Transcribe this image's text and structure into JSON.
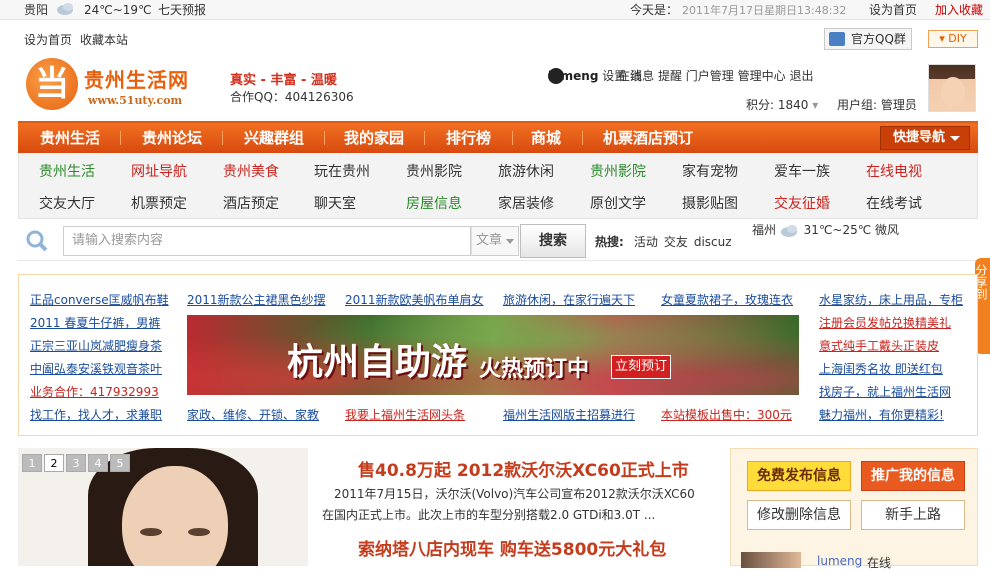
{
  "topbar": {
    "city": "贵阳",
    "temp": "24℃~19℃",
    "forecast": "七天预报",
    "today_label": "今天是：",
    "date": "2011年7月17日星期日13:48:32",
    "set_home": "设为首页",
    "add_fav": "加入收藏"
  },
  "bar2": {
    "set_home": "设为首页",
    "bookmark": "收藏本站",
    "qq_group": "官方QQ群",
    "diy": "DIY"
  },
  "logo": {
    "char": "当",
    "name": "贵州生活网",
    "url": "www.51uty.com"
  },
  "slogan": "真实 - 丰富 - 温暖",
  "coop": "合作QQ：404126306",
  "user": {
    "name": "lumeng",
    "status": "在线",
    "links": [
      "设置",
      "消息",
      "提醒",
      "门户管理",
      "管理中心",
      "退出"
    ],
    "points_label": "积分: 1840",
    "group": "用户组: 管理员"
  },
  "nav": {
    "items": [
      "贵州生活",
      "贵州论坛",
      "兴趣群组",
      "我的家园",
      "排行榜",
      "商城",
      "机票酒店预订"
    ],
    "quick": "快捷导航"
  },
  "subnav": {
    "row1": [
      "贵州生活",
      "网址导航",
      "贵州美食",
      "玩在贵州",
      "贵州影院",
      "旅游休闲",
      "贵州影院",
      "家有宠物",
      "爱车一族",
      "在线电视"
    ],
    "row2": [
      "交友大厅",
      "机票预定",
      "酒店预定",
      "聊天室",
      "房屋信息",
      "家居装修",
      "原创文学",
      "摄影贴图",
      "交友征婚",
      "在线考试"
    ],
    "row1_colors": [
      "#2a8a2a",
      "#c8241e",
      "#c8241e",
      "#333333",
      "#333333",
      "#333333",
      "#2a8a2a",
      "#333333",
      "#333333",
      "#c8241e"
    ],
    "row2_colors": [
      "#333333",
      "#333333",
      "#333333",
      "#333333",
      "#2a8a2a",
      "#333333",
      "#333333",
      "#333333",
      "#c8241e",
      "#333333"
    ]
  },
  "search": {
    "placeholder": "请输入搜索内容",
    "type": "文章",
    "button": "搜索",
    "hot_label": "热搜:",
    "hot": [
      "活动",
      "交友",
      "discuz"
    ],
    "weather_city": "福州",
    "weather_temp": "31℃~25℃",
    "weather_wind": "微风"
  },
  "side_tab": "分享到",
  "ads": {
    "left": [
      "正品converse匡威帆布鞋",
      "2011 春夏牛仔裤，男裤",
      "正宗三亚山岚减肥瘦身茶",
      "中阖弘泰安溪铁观音茶叶",
      "业务合作：417932993",
      "找工作，找人才，求兼职"
    ],
    "left_colors": [
      "#1a4c9c",
      "#1a4c9c",
      "#1a4c9c",
      "#1a4c9c",
      "#c8241e",
      "#1a4c9c"
    ],
    "top": [
      "2011新款公主裙黑色纱摆",
      "2011新款欧美帆布单肩女",
      "旅游休闲，在家行遍天下",
      "女童夏款裙子，玫瑰连衣"
    ],
    "bottom": [
      "家政、维修、开锁、家教",
      "我要上福州生活网头条",
      "福州生活网版主招募进行",
      "本站模板出售中：300元"
    ],
    "bottom_colors": [
      "#1a4c9c",
      "#c8241e",
      "#1a4c9c",
      "#c8241e"
    ],
    "right": [
      "水星家纺，床上用品，专柜",
      "注册会员发帖兑换精美礼",
      "意式纯手工戴头正装皮",
      "上海闺秀名妆 即送红包",
      "找房子，就上福州生活网",
      "魅力福州，有你更精彩!"
    ],
    "right_colors": [
      "#1a4c9c",
      "#c8241e",
      "#c8241e",
      "#1a4c9c",
      "#1a4c9c",
      "#1a4c9c"
    ],
    "banner_title": "杭州自助游",
    "banner_sub": "火热预订中",
    "banner_cta": "立刻预订"
  },
  "slider": {
    "pages": [
      "1",
      "2",
      "3",
      "4",
      "5"
    ],
    "active": "2"
  },
  "news": {
    "headline": "售40.8万起 2012款沃尔沃XC60正式上市",
    "summary": "2011年7月15日，沃尔沃(Volvo)汽车公司宣布2012款沃尔沃XC60在国内正式上市。此次上市的车型分别搭载2.0 GTDi和3.0T ...",
    "headline2": "索纳塔八店内现车 购车送5800元大礼包"
  },
  "actions": {
    "publish": "免费发布信息",
    "promote": "推广我的信息",
    "edit": "修改删除信息",
    "newbie": "新手上路"
  },
  "mini_user": {
    "name": "lumeng",
    "status": "在线"
  }
}
